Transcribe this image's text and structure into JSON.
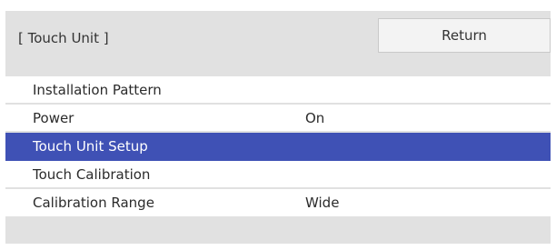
{
  "header": {
    "title": "[ Touch Unit ]",
    "return_label": "Return"
  },
  "menu": {
    "items": [
      {
        "label": "Installation Pattern",
        "value": ""
      },
      {
        "label": "Power",
        "value": "On"
      },
      {
        "label": "Touch Unit Setup",
        "value": "",
        "selected": true
      },
      {
        "label": "Touch Calibration",
        "value": ""
      },
      {
        "label": "Calibration Range",
        "value": "Wide"
      }
    ]
  },
  "colors": {
    "panel_bg": "#e1e1e1",
    "selection": "#3f51b5",
    "row_bg": "#ffffff"
  }
}
